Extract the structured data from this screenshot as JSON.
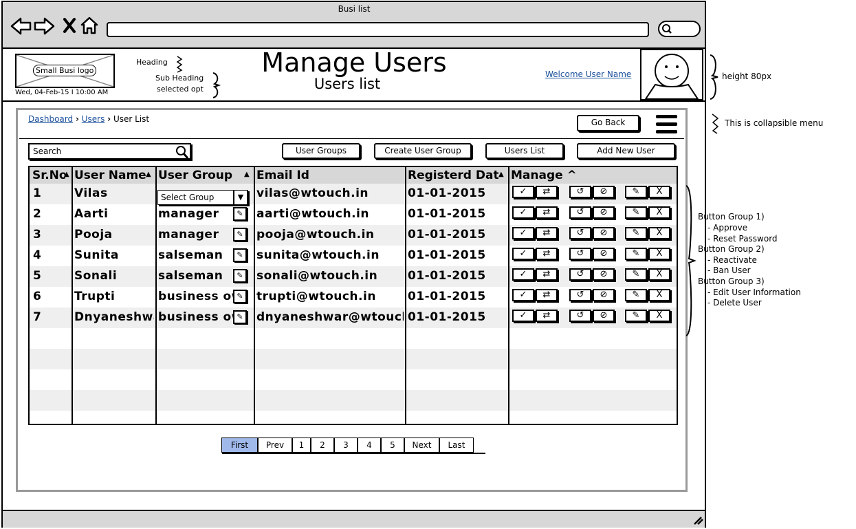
{
  "window": {
    "title": "Busi list"
  },
  "nav_icons": [
    "back-arrow-icon",
    "forward-arrow-icon",
    "close-x-icon",
    "home-icon"
  ],
  "header": {
    "logo_text": "Small Busi logo",
    "datetime": "Wed, 04-Feb-15 I 10:00 AM",
    "note_heading": "Heading",
    "note_subheading": "Sub Heading",
    "note_selected": "selected opt",
    "title": "Manage Users",
    "subtitle": "Users list",
    "welcome": "Welcome User Name"
  },
  "breadcrumb": {
    "items": [
      "Dashboard",
      "Users",
      "User List"
    ]
  },
  "toolbar": {
    "go_back": "Go Back",
    "search_placeholder": "Search",
    "buttons": [
      "User Groups",
      "Create User Group",
      "Users List",
      "Add New User"
    ]
  },
  "table": {
    "columns": [
      "Sr.No",
      "User Name",
      "User Group",
      "Email Id",
      "Registerd Date",
      "Manage ^"
    ],
    "select_placeholder": "Select Group",
    "rows": [
      {
        "sr": "1",
        "name": "Vilas",
        "group": "",
        "email": "vilas@wtouch.in",
        "date": "01-01-2015"
      },
      {
        "sr": "2",
        "name": "Aarti",
        "group": "manager",
        "email": "aarti@wtouch.in",
        "date": "01-01-2015"
      },
      {
        "sr": "3",
        "name": "Pooja",
        "group": "manager",
        "email": "pooja@wtouch.in",
        "date": "01-01-2015"
      },
      {
        "sr": "4",
        "name": "Sunita",
        "group": "salseman",
        "email": "sunita@wtouch.in",
        "date": "01-01-2015"
      },
      {
        "sr": "5",
        "name": "Sonali",
        "group": "salseman",
        "email": "sonali@wtouch.in",
        "date": "01-01-2015"
      },
      {
        "sr": "6",
        "name": "Trupti",
        "group": "business owner",
        "email": "trupti@wtouch.in",
        "date": "01-01-2015"
      },
      {
        "sr": "7",
        "name": "Dnyaneshwar",
        "group": "business owner",
        "email": "dnyaneshwar@wtouch.in",
        "date": "01-01-2015"
      }
    ],
    "manage_icons": [
      "approve-check-icon",
      "reset-password-icon",
      "reactivate-icon",
      "ban-icon",
      "edit-pencil-icon",
      "delete-x-icon"
    ]
  },
  "pagination": [
    "First",
    "Prev",
    "1",
    "2",
    "3",
    "4",
    "5",
    "Next",
    "Last"
  ],
  "annotations": {
    "height": "height 80px",
    "menu": "This is collapsible menu",
    "groups": [
      {
        "title": "Button Group 1)",
        "items": [
          "Approve",
          "Reset Password"
        ]
      },
      {
        "title": "Button Group 2)",
        "items": [
          "Reactivate",
          "Ban User"
        ]
      },
      {
        "title": "Button Group 3)",
        "items": [
          "Edit User Information",
          "Delete User"
        ]
      }
    ]
  }
}
